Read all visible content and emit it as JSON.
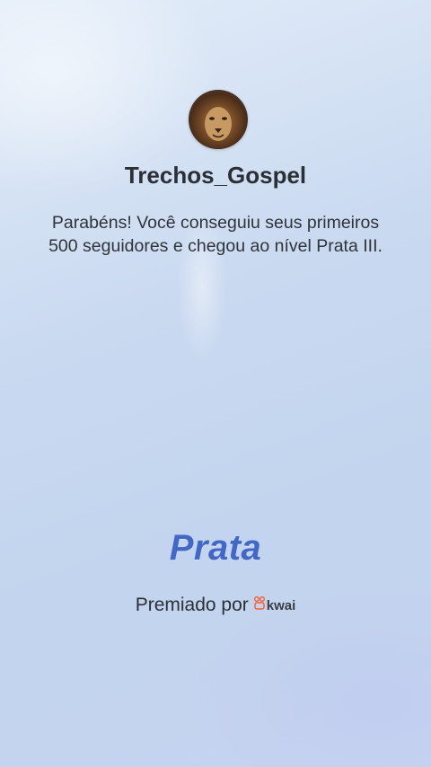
{
  "profile": {
    "username": "Trechos_Gospel",
    "avatar_icon": "lion-avatar-icon"
  },
  "message": {
    "text": "Parabéns! Você conseguiu seus primeiros 500 seguidores e chegou ao nível Prata III."
  },
  "tier": {
    "label": "Prata",
    "color": "#4168c8"
  },
  "footer": {
    "awarded_by_label": "Premiado por",
    "brand_name": "kwai",
    "brand_icon": "kwai-logo-icon",
    "brand_color": "#ff5a2c"
  }
}
